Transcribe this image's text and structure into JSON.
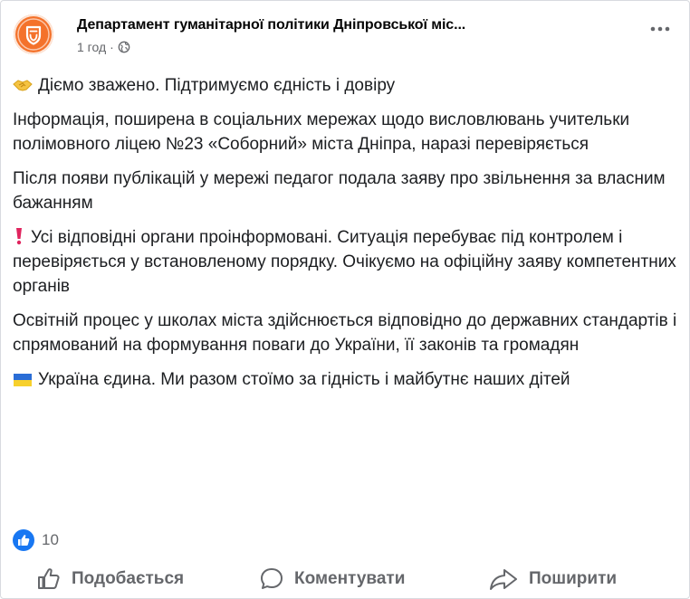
{
  "header": {
    "page_name": "Департамент гуманітарної політики Дніпровської міс...",
    "time": "1 год",
    "separator": "·",
    "avatar_icon": "shield-logo-icon",
    "privacy_icon": "globe-icon",
    "more_icon": "more-horizontal-icon"
  },
  "post": {
    "paragraphs": [
      {
        "emoji": "handshake",
        "text": "Діємо зважено. Підтримуємо єдність і довіру"
      },
      {
        "text": "Інформація, поширена в соціальних мережах щодо висловлювань учительки полімовного ліцею №23 «Соборний» міста Дніпра, наразі перевіряється"
      },
      {
        "text": "Після появи публікацій у мережі педагог подала заяву про звільнення за власним бажанням"
      },
      {
        "emoji": "exclamation",
        "text": "Усі відповідні органи проінформовані. Ситуація перебуває під контролем і перевіряється у встановленому порядку. Очікуємо на офіційну заяву компетентних органів"
      },
      {
        "text": "Освітній процес у школах міста здійснюється відповідно до державних стандартів і спрямований на формування поваги до України, її законів та громадян"
      },
      {
        "emoji": "ukraine-flag",
        "text": "Україна єдина. Ми разом стоїмо за гідність і майбутнє наших дітей"
      }
    ]
  },
  "reactions": {
    "icon": "like-reaction-icon",
    "count": "10"
  },
  "actions": {
    "like": "Подобається",
    "comment": "Коментувати",
    "share": "Поширити"
  },
  "colors": {
    "brand_orange": "#f4722b",
    "facebook_blue": "#1877f2",
    "secondary_text": "#65676b"
  }
}
